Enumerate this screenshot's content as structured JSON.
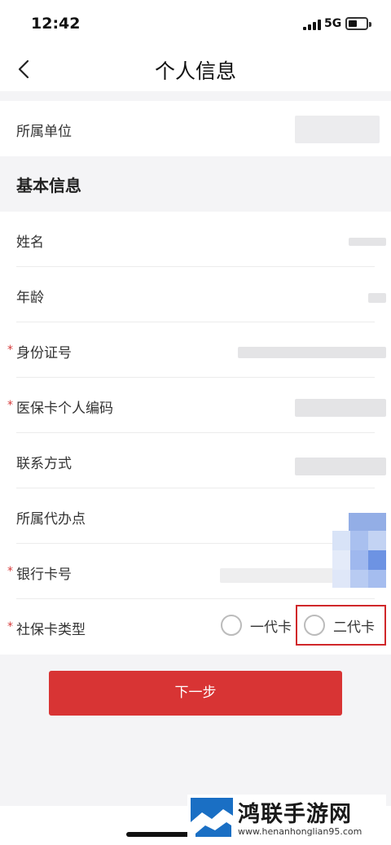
{
  "status": {
    "time": "12:42",
    "network": "5G"
  },
  "nav": {
    "title": "个人信息"
  },
  "org": {
    "label": "所属单位"
  },
  "section": {
    "title": "基本信息"
  },
  "fields": [
    {
      "label": "姓名",
      "required": false
    },
    {
      "label": "年龄",
      "required": false
    },
    {
      "label": "身份证号",
      "required": true
    },
    {
      "label": "医保卡个人编码",
      "required": true
    },
    {
      "label": "联系方式",
      "required": false
    },
    {
      "label": "所属代办点",
      "required": false
    },
    {
      "label": "银行卡号",
      "required": true
    }
  ],
  "card_type": {
    "label": "社保卡类型",
    "required_mark": "*",
    "options": [
      "一代卡",
      "二代卡"
    ]
  },
  "next_button": "下一步",
  "watermark": {
    "name": "鸿联手游网",
    "url": "www.henanhonglian95.com"
  },
  "colors": {
    "accent": "#d83434",
    "highlight": "#d0272a",
    "required": "#d63a3a"
  }
}
